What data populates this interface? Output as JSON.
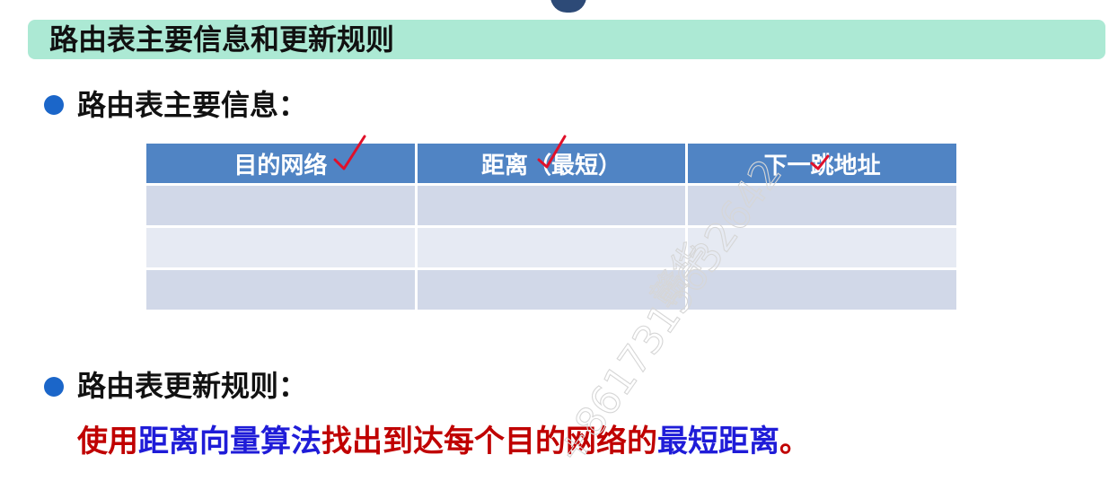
{
  "title": "路由表主要信息和更新规则",
  "section1": {
    "heading": "路由表主要信息："
  },
  "table": {
    "headers": [
      "目的网络",
      "距离（最短）",
      "下一跳地址"
    ],
    "rows": [
      [
        "",
        "",
        ""
      ],
      [
        "",
        "",
        ""
      ],
      [
        "",
        "",
        ""
      ]
    ]
  },
  "section2": {
    "heading": "路由表更新规则：",
    "rule_parts": [
      {
        "text": "使用",
        "color": "red"
      },
      {
        "text": "距离向量算法",
        "color": "blue"
      },
      {
        "text": "找出到达每个目的网络的",
        "color": "red"
      },
      {
        "text": "最短距离",
        "color": "blue"
      },
      {
        "text": "。",
        "color": "red"
      }
    ]
  },
  "watermark": {
    "name": "赣华",
    "number": "+8617315632642"
  },
  "colors": {
    "title_bar": "#ace9d4",
    "bullet": "#1b66c9",
    "table_header": "#5084c4",
    "row_dark": "#d1d8e8",
    "row_light": "#e6eaf3",
    "rule_red": "#c00000",
    "rule_blue": "#1f1cd8",
    "checkmark": "#e0102a"
  }
}
